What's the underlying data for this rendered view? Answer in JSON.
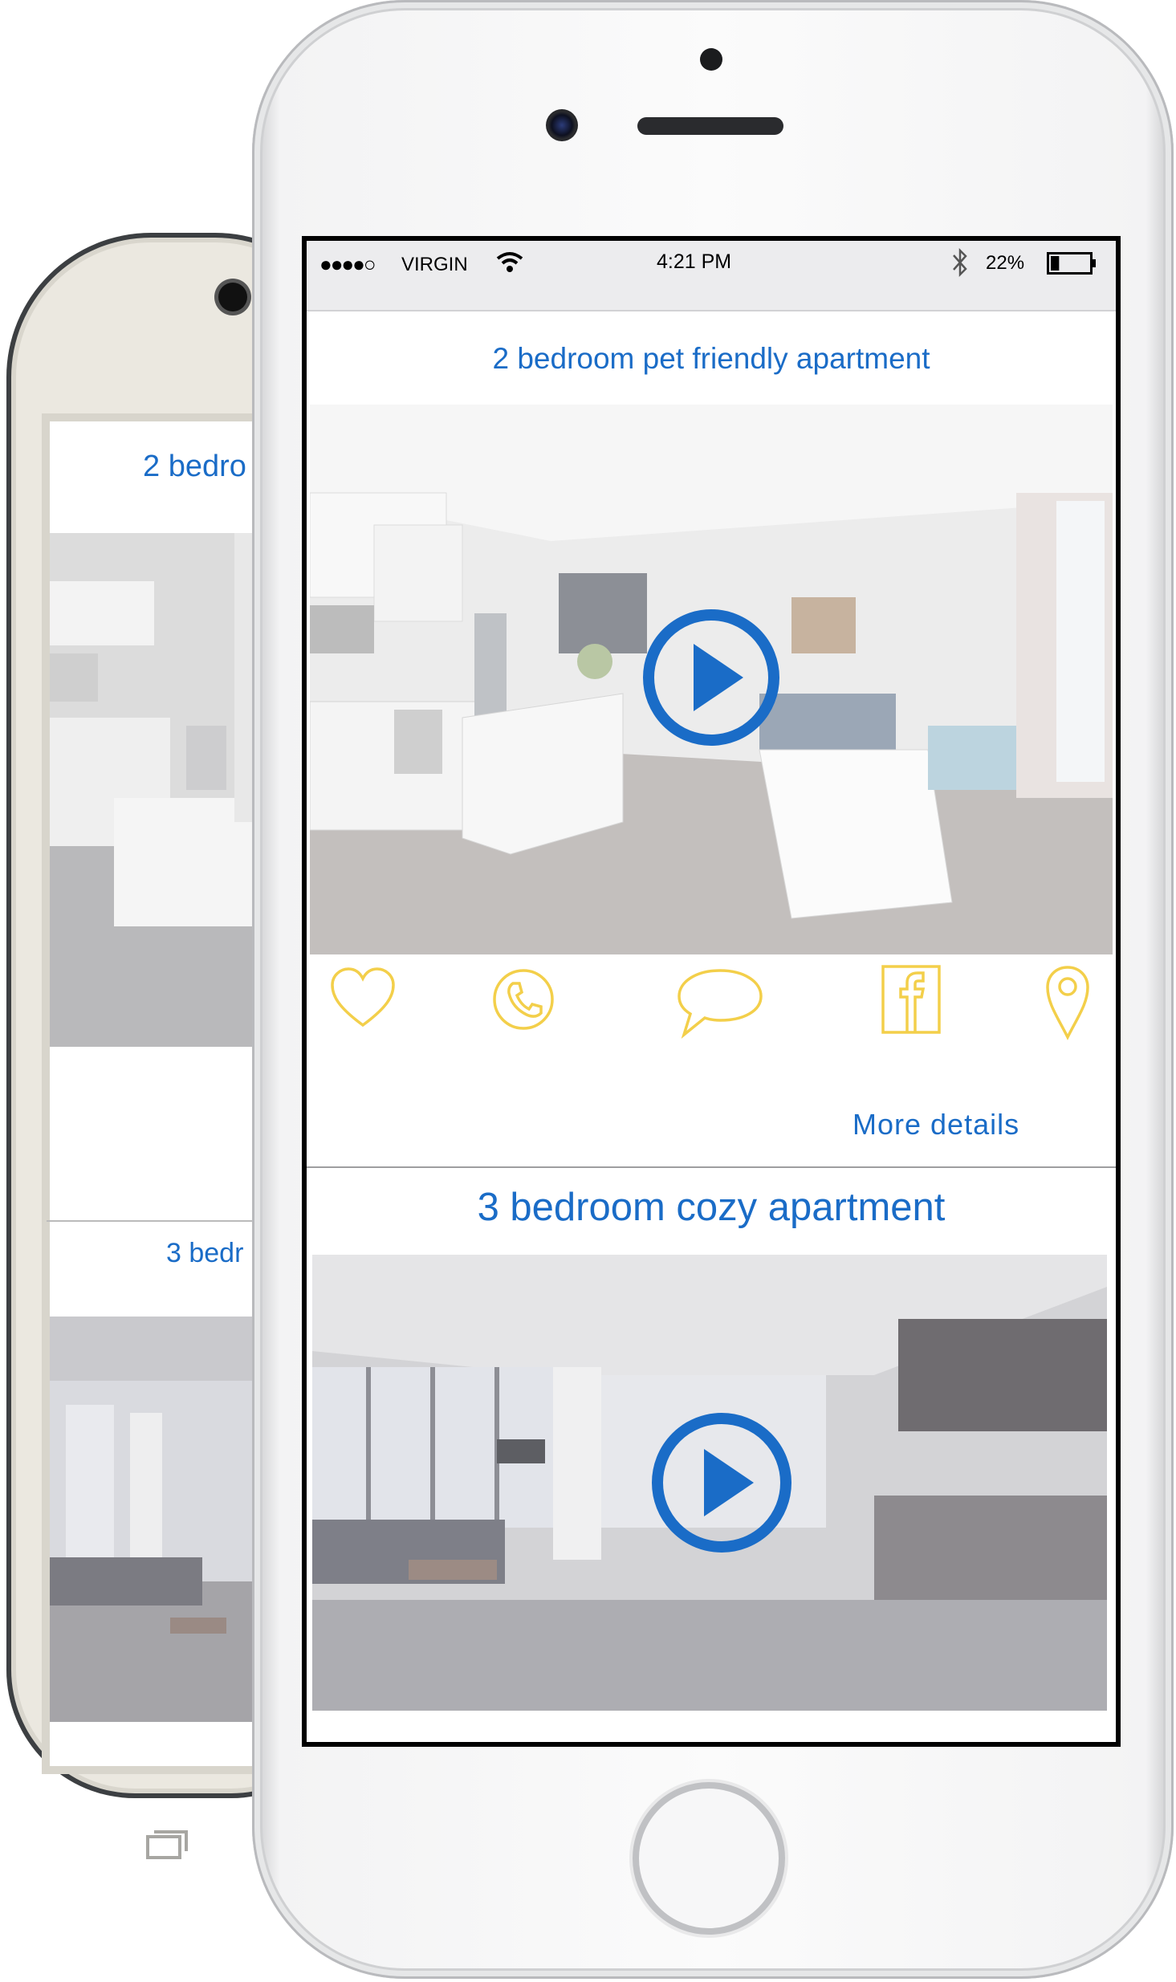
{
  "status_bar": {
    "signal": "●●●●○",
    "carrier": "VIRGIN",
    "time": "4:21 PM",
    "battery": "22%",
    "battery_level": 0.22
  },
  "listings": [
    {
      "title": "2 bedroom pet friendly apartment",
      "image": "apartment-interior-photo",
      "actions": [
        "heart-icon",
        "phone-icon",
        "chat-icon",
        "facebook-icon",
        "location-pin-icon"
      ],
      "more_label": "More details"
    },
    {
      "title": "3 bedroom cozy apartment",
      "image": "apartment-interior-photo"
    }
  ],
  "back_phone": {
    "title1": "2 bedro",
    "title2": "3 bedr"
  },
  "colors": {
    "accent_blue": "#1a6cc7",
    "icon_yellow": "#f3cf4a",
    "play_blue": "#1a6cc7"
  }
}
